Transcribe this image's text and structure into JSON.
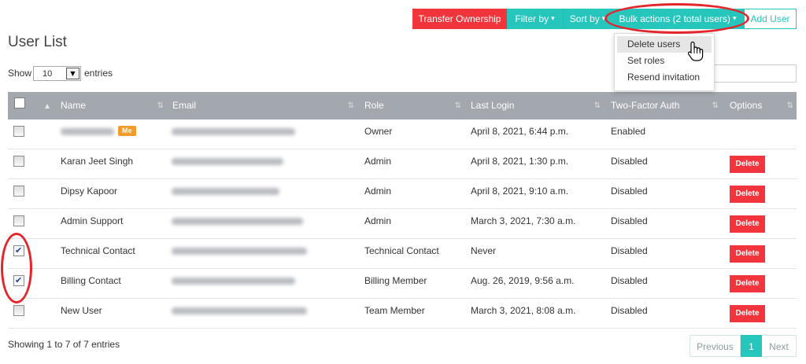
{
  "page": {
    "title": "User List"
  },
  "toolbar": {
    "transfer_ownership": "Transfer Ownership",
    "filter_by": "Filter by",
    "sort_by": "Sort by",
    "bulk_actions": "Bulk actions (2 total users)",
    "add_user": "Add User"
  },
  "bulk_menu": {
    "items": [
      "Delete users",
      "Set roles",
      "Resend invitation"
    ],
    "hovered_index": 0
  },
  "length_control": {
    "prefix": "Show",
    "value": "10",
    "suffix": "entries"
  },
  "search": {
    "value": ""
  },
  "table": {
    "select_all_checked": false,
    "columns": {
      "name": "Name",
      "email": "Email",
      "role": "Role",
      "last_login": "Last Login",
      "two_factor": "Two-Factor Auth",
      "options": "Options"
    },
    "rows": [
      {
        "checked": false,
        "badge": "Me",
        "role": "Owner",
        "last_login": "April 8, 2021, 6:44 p.m.",
        "two_factor": "Enabled"
      },
      {
        "checked": false,
        "name": "Karan Jeet Singh",
        "role": "Admin",
        "last_login": "April 8, 2021, 1:30 p.m.",
        "two_factor": "Disabled",
        "delete": "Delete"
      },
      {
        "checked": false,
        "name": "Dipsy Kapoor",
        "role": "Admin",
        "last_login": "April 8, 2021, 9:10 a.m.",
        "two_factor": "Disabled",
        "delete": "Delete"
      },
      {
        "checked": false,
        "name": "Admin Support",
        "role": "Admin",
        "last_login": "March 3, 2021, 7:30 a.m.",
        "two_factor": "Disabled",
        "delete": "Delete"
      },
      {
        "checked": true,
        "name": "Technical Contact",
        "role": "Technical Contact",
        "last_login": "Never",
        "two_factor": "Disabled",
        "delete": "Delete"
      },
      {
        "checked": true,
        "name": "Billing Contact",
        "role": "Billing Member",
        "last_login": "Aug. 26, 2019, 9:56 a.m.",
        "two_factor": "Disabled",
        "delete": "Delete"
      },
      {
        "checked": false,
        "name": "New User",
        "role": "Team Member",
        "last_login": "March 3, 2021, 8:08 a.m.",
        "two_factor": "Disabled",
        "delete": "Delete"
      }
    ]
  },
  "footer": {
    "info": "Showing 1 to 7 of 7 entries"
  },
  "pagination": {
    "previous": "Previous",
    "current": "1",
    "next": "Next"
  },
  "icons": {
    "dropdown_caret": "caret-down-icon",
    "select_arrow": "triangle-down-icon",
    "checkbox_column_sort": "sort-asc-icon",
    "column_sort": "sort-both-icon",
    "cursor": "hand-pointer-icon"
  },
  "colors": {
    "accent": "#26c6bd",
    "danger": "#f2353c",
    "header": "#a3a7ae",
    "badge": "#f39c2c",
    "annotation": "#e3262b"
  }
}
